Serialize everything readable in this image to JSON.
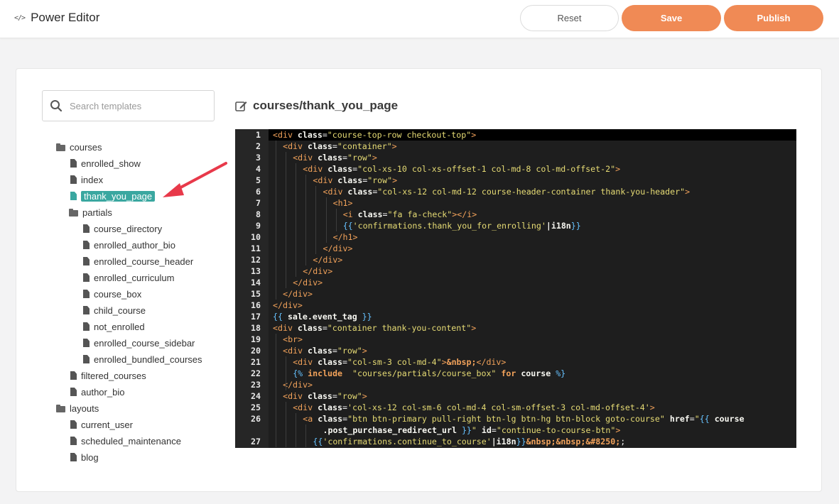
{
  "header": {
    "app_icon": "code-icon",
    "title": "Power Editor",
    "reset_label": "Reset",
    "save_label": "Save",
    "publish_label": "Publish",
    "accent_color": "#f08a55"
  },
  "sidebar": {
    "search_placeholder": "Search templates",
    "tree": [
      {
        "name": "courses",
        "type": "folder",
        "depth": 0
      },
      {
        "name": "enrolled_show",
        "type": "file",
        "depth": 1
      },
      {
        "name": "index",
        "type": "file",
        "depth": 1
      },
      {
        "name": "thank_you_page",
        "type": "file",
        "depth": 1,
        "active": true
      },
      {
        "name": "partials",
        "type": "folder",
        "depth": 1
      },
      {
        "name": "course_directory",
        "type": "file",
        "depth": 2
      },
      {
        "name": "enrolled_author_bio",
        "type": "file",
        "depth": 2
      },
      {
        "name": "enrolled_course_header",
        "type": "file",
        "depth": 2
      },
      {
        "name": "enrolled_curriculum",
        "type": "file",
        "depth": 2
      },
      {
        "name": "course_box",
        "type": "file",
        "depth": 2
      },
      {
        "name": "child_course",
        "type": "file",
        "depth": 2
      },
      {
        "name": "not_enrolled",
        "type": "file",
        "depth": 2
      },
      {
        "name": "enrolled_course_sidebar",
        "type": "file",
        "depth": 2
      },
      {
        "name": "enrolled_bundled_courses",
        "type": "file",
        "depth": 2
      },
      {
        "name": "filtered_courses",
        "type": "file",
        "depth": 1
      },
      {
        "name": "author_bio",
        "type": "file",
        "depth": 1
      },
      {
        "name": "layouts",
        "type": "folder",
        "depth": 0
      },
      {
        "name": "current_user",
        "type": "file",
        "depth": 1
      },
      {
        "name": "scheduled_maintenance",
        "type": "file",
        "depth": 1
      },
      {
        "name": "blog",
        "type": "file",
        "depth": 1
      }
    ],
    "active_color": "#3aa7a0"
  },
  "editor": {
    "file_path": "courses/thank_you_page",
    "lines": [
      {
        "n": "1",
        "indent": 0,
        "tokens": [
          [
            "tag",
            "<div "
          ],
          [
            "attr",
            "class"
          ],
          [
            "plain",
            "="
          ],
          [
            "str",
            "\"course-top-row checkout-top\""
          ],
          [
            "tag",
            ">"
          ]
        ]
      },
      {
        "n": "2",
        "indent": 1,
        "tokens": [
          [
            "tag",
            "<div "
          ],
          [
            "attr",
            "class"
          ],
          [
            "plain",
            "="
          ],
          [
            "str",
            "\"container\""
          ],
          [
            "tag",
            ">"
          ]
        ]
      },
      {
        "n": "3",
        "indent": 2,
        "tokens": [
          [
            "tag",
            "<div "
          ],
          [
            "attr",
            "class"
          ],
          [
            "plain",
            "="
          ],
          [
            "str",
            "\"row\""
          ],
          [
            "tag",
            ">"
          ]
        ]
      },
      {
        "n": "4",
        "indent": 3,
        "tokens": [
          [
            "tag",
            "<div "
          ],
          [
            "attr",
            "class"
          ],
          [
            "plain",
            "="
          ],
          [
            "str",
            "\"col-xs-10 col-xs-offset-1 col-md-8 col-md-offset-2\""
          ],
          [
            "tag",
            ">"
          ]
        ]
      },
      {
        "n": "5",
        "indent": 4,
        "tokens": [
          [
            "tag",
            "<div "
          ],
          [
            "attr",
            "class"
          ],
          [
            "plain",
            "="
          ],
          [
            "str",
            "\"row\""
          ],
          [
            "tag",
            ">"
          ]
        ]
      },
      {
        "n": "6",
        "indent": 5,
        "tokens": [
          [
            "tag",
            "<div "
          ],
          [
            "attr",
            "class"
          ],
          [
            "plain",
            "="
          ],
          [
            "str",
            "\"col-xs-12 col-md-12 course-header-container thank-you-header\""
          ],
          [
            "tag",
            ">"
          ]
        ]
      },
      {
        "n": "7",
        "indent": 6,
        "tokens": [
          [
            "tag",
            "<h1>"
          ]
        ]
      },
      {
        "n": "8",
        "indent": 7,
        "tokens": [
          [
            "tag",
            "<i "
          ],
          [
            "attr",
            "class"
          ],
          [
            "plain",
            "="
          ],
          [
            "str",
            "\"fa fa-check\""
          ],
          [
            "tag",
            "></i>"
          ]
        ]
      },
      {
        "n": "9",
        "indent": 7,
        "tokens": [
          [
            "tpl",
            "{{"
          ],
          [
            "str",
            "'confirmations.thank_you_for_enrolling'"
          ],
          [
            "bold",
            "|i18n"
          ],
          [
            "tpl",
            "}}"
          ]
        ]
      },
      {
        "n": "10",
        "indent": 6,
        "tokens": [
          [
            "tag",
            "</h1>"
          ]
        ]
      },
      {
        "n": "11",
        "indent": 5,
        "tokens": [
          [
            "tag",
            "</div>"
          ]
        ]
      },
      {
        "n": "12",
        "indent": 4,
        "tokens": [
          [
            "tag",
            "</div>"
          ]
        ]
      },
      {
        "n": "13",
        "indent": 3,
        "tokens": [
          [
            "tag",
            "</div>"
          ]
        ]
      },
      {
        "n": "14",
        "indent": 2,
        "tokens": [
          [
            "tag",
            "</div>"
          ]
        ]
      },
      {
        "n": "15",
        "indent": 1,
        "tokens": [
          [
            "tag",
            "</div>"
          ]
        ]
      },
      {
        "n": "16",
        "indent": 0,
        "tokens": [
          [
            "tag",
            "</div>"
          ]
        ]
      },
      {
        "n": "17",
        "indent": 0,
        "tokens": [
          [
            "tpl",
            "{{ "
          ],
          [
            "bold",
            "sale.event_tag"
          ],
          [
            "tpl",
            " }}"
          ]
        ]
      },
      {
        "n": "18",
        "indent": 0,
        "tokens": [
          [
            "tag",
            "<div "
          ],
          [
            "attr",
            "class"
          ],
          [
            "plain",
            "="
          ],
          [
            "str",
            "\"container thank-you-content\""
          ],
          [
            "tag",
            ">"
          ]
        ]
      },
      {
        "n": "19",
        "indent": 1,
        "tokens": [
          [
            "tag",
            "<br>"
          ]
        ]
      },
      {
        "n": "20",
        "indent": 1,
        "tokens": [
          [
            "tag",
            "<div "
          ],
          [
            "attr",
            "class"
          ],
          [
            "plain",
            "="
          ],
          [
            "str",
            "\"row\""
          ],
          [
            "tag",
            ">"
          ]
        ]
      },
      {
        "n": "21",
        "indent": 2,
        "tokens": [
          [
            "tag",
            "<div "
          ],
          [
            "attr",
            "class"
          ],
          [
            "plain",
            "="
          ],
          [
            "str",
            "\"col-sm-3 col-md-4\""
          ],
          [
            "tag",
            ">"
          ],
          [
            "ent",
            "&nbsp;"
          ],
          [
            "tag",
            "</div>"
          ]
        ]
      },
      {
        "n": "22",
        "indent": 2,
        "tokens": [
          [
            "tpl",
            "{% "
          ],
          [
            "key",
            "include"
          ],
          [
            "plain",
            "  "
          ],
          [
            "str",
            "\"courses/partials/course_box\""
          ],
          [
            "plain",
            " "
          ],
          [
            "key",
            "for"
          ],
          [
            "plain",
            " "
          ],
          [
            "bold",
            "course"
          ],
          [
            "plain",
            " "
          ],
          [
            "tpl",
            "%}"
          ]
        ]
      },
      {
        "n": "23",
        "indent": 1,
        "tokens": [
          [
            "tag",
            "</div>"
          ]
        ]
      },
      {
        "n": "24",
        "indent": 1,
        "tokens": [
          [
            "tag",
            "<div "
          ],
          [
            "attr",
            "class"
          ],
          [
            "plain",
            "="
          ],
          [
            "str",
            "\"row\""
          ],
          [
            "tag",
            ">"
          ]
        ]
      },
      {
        "n": "25",
        "indent": 2,
        "tokens": [
          [
            "tag",
            "<div "
          ],
          [
            "attr",
            "class"
          ],
          [
            "plain",
            "="
          ],
          [
            "str",
            "'col-xs-12 col-sm-6 col-md-4 col-sm-offset-3 col-md-offset-4'"
          ],
          [
            "tag",
            ">"
          ]
        ]
      },
      {
        "n": "26",
        "indent": 3,
        "tokens": [
          [
            "tag",
            "<a "
          ],
          [
            "attr",
            "class"
          ],
          [
            "plain",
            "="
          ],
          [
            "str",
            "\"btn btn-primary pull-right btn-lg btn-hg btn-block goto-course\""
          ],
          [
            "plain",
            " "
          ],
          [
            "attr",
            "href"
          ],
          [
            "plain",
            "="
          ],
          [
            "str",
            "\""
          ],
          [
            "tpl",
            "{{ "
          ],
          [
            "bold",
            "course"
          ]
        ]
      },
      {
        "n": "",
        "indent": 5,
        "tokens": [
          [
            "bold",
            ".post_purchase_redirect_url"
          ],
          [
            "tpl",
            " }}"
          ],
          [
            "str",
            "\""
          ],
          [
            "plain",
            " "
          ],
          [
            "attr",
            "id"
          ],
          [
            "plain",
            "="
          ],
          [
            "str",
            "\"continue-to-course-btn\""
          ],
          [
            "tag",
            ">"
          ]
        ]
      },
      {
        "n": "27",
        "indent": 4,
        "tokens": [
          [
            "tpl",
            "{{"
          ],
          [
            "str",
            "'confirmations.continue_to_course'"
          ],
          [
            "bold",
            "|i18n"
          ],
          [
            "tpl",
            "}}"
          ],
          [
            "ent",
            "&nbsp;&nbsp;&#8250;"
          ],
          [
            "plain",
            ";"
          ]
        ]
      }
    ]
  }
}
